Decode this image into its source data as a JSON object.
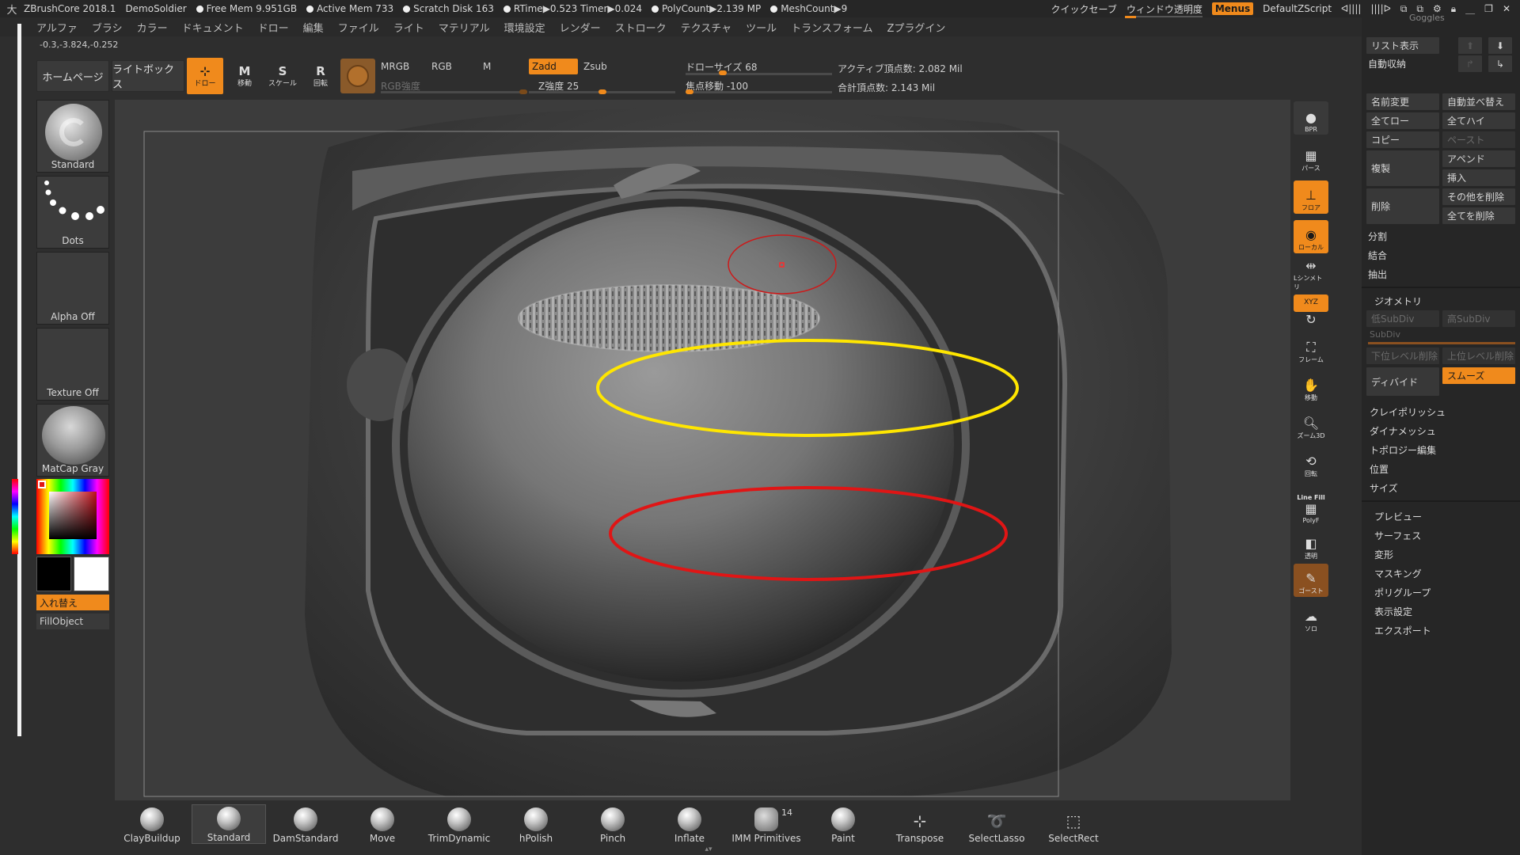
{
  "titlebar": {
    "app": "ZBrushCore 2018.1",
    "project": "DemoSoldier",
    "free_mem": "Free Mem 9.951GB",
    "active_mem": "Active Mem 733",
    "scratch": "Scratch Disk 163",
    "rtime": "RTime▶0.523 Timer▶0.024",
    "polycount": "PolyCount▶2.139 MP",
    "meshcount": "MeshCount▶9",
    "quicksave": "クイックセーブ",
    "transparency": "ウィンドウ透明度",
    "menus": "Menus",
    "script": "DefaultZScript"
  },
  "menubar": [
    "アルファ",
    "ブラシ",
    "カラー",
    "ドキュメント",
    "ドロー",
    "編集",
    "ファイル",
    "ライト",
    "マテリアル",
    "環境設定",
    "レンダー",
    "ストローク",
    "テクスチャ",
    "ツール",
    "トランスフォーム",
    "Zプラグイン"
  ],
  "coords": "-0.3,-3.824,-0.252",
  "toolbar": {
    "home": "ホームページ",
    "lightbox": "ライトボックス",
    "draw": "ドロー",
    "move": "移動",
    "scale": "スケール",
    "rotate": "回転",
    "mrgb": "MRGB",
    "rgb": "RGB",
    "m": "M",
    "rgb_intensity": "RGB強度",
    "zadd": "Zadd",
    "zsub": "Zsub",
    "z_intensity": "Z強度 25",
    "draw_size": "ドローサイズ 68",
    "focal_shift": "焦点移動 -100",
    "active_points": "アクティブ頂点数: 2.082 Mil",
    "total_points": "合計頂点数: 2.143 Mil"
  },
  "left_panel": {
    "brush": "Standard",
    "stroke": "Dots",
    "alpha": "Alpha Off",
    "texture": "Texture Off",
    "material": "MatCap Gray",
    "swap": "入れ替え",
    "fill": "FillObject"
  },
  "right_tools": [
    "BPR",
    "パース",
    "フロア",
    "ローカル",
    "Lシンメトリ",
    "XYZ",
    "フレーム",
    "移動",
    "ズーム3D",
    "回転",
    "Line Fill",
    "PolyF",
    "透明",
    "ゴースト",
    "ソロ"
  ],
  "right_panel": {
    "goggles": "Goggles",
    "list_view": "リスト表示",
    "auto_collapse": "自動収納",
    "rename": "名前変更",
    "auto_sort": "自動並べ替え",
    "all_low": "全てロー",
    "all_high": "全てハイ",
    "copy": "コピー",
    "paste": "ペースト",
    "duplicate": "複製",
    "append": "アペンド",
    "insert": "挿入",
    "delete": "削除",
    "delete_other": "その他を削除",
    "delete_all": "全てを削除",
    "split": "分割",
    "merge": "結合",
    "extract": "抽出",
    "geometry": "ジオメトリ",
    "lower_subdiv": "低SubDiv",
    "higher_subdiv": "高SubDiv",
    "subdiv": "SubDiv",
    "del_lower": "下位レベル削除",
    "del_higher": "上位レベル削除",
    "divide": "ディバイド",
    "smooth": "スムーズ",
    "claypolish": "クレイポリッシュ",
    "dynamesh": "ダイナメッシュ",
    "topology": "トポロジー編集",
    "position": "位置",
    "size": "サイズ",
    "preview": "プレビュー",
    "surface": "サーフェス",
    "deformation": "変形",
    "masking": "マスキング",
    "polygroups": "ポリグループ",
    "display": "表示設定",
    "export": "エクスポート"
  },
  "brushes": [
    "ClayBuildup",
    "Standard",
    "DamStandard",
    "Move",
    "TrimDynamic",
    "hPolish",
    "Pinch",
    "Inflate",
    "IMM Primitives",
    "Paint",
    "Transpose",
    "SelectLasso",
    "SelectRect"
  ],
  "brush_badge": "14",
  "colors": {
    "accent": "#f08a1c",
    "annotation_yellow": "#ffe600",
    "annotation_red": "#e01515"
  }
}
